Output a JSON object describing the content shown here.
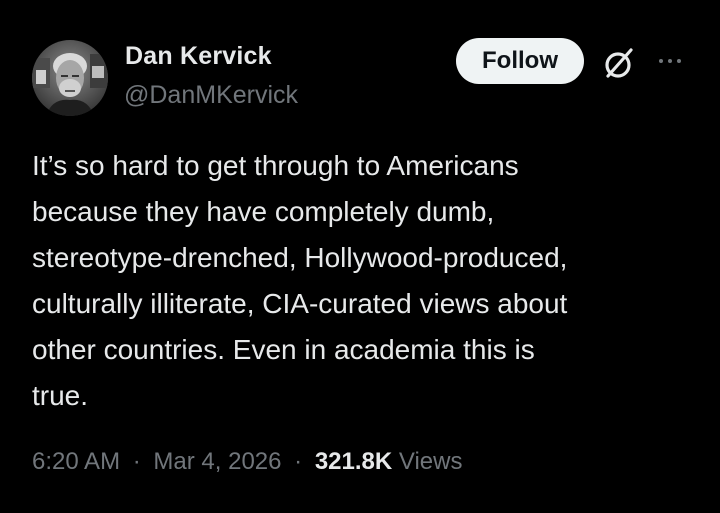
{
  "author": {
    "display_name": "Dan Kervick",
    "handle": "@DanMKervick",
    "avatar_icon": "profile-photo"
  },
  "actions": {
    "follow_label": "Follow",
    "grok_icon": "grok-icon",
    "more_icon": "more-options-icon"
  },
  "tweet": {
    "text": "It’s so hard to get through to Americans\nbecause they have completely dumb,\nstereotype-drenched, Hollywood-produced,\nculturally illiterate, CIA-curated views about\nother countries. Even in academia this is\ntrue."
  },
  "meta": {
    "time": "6:20 AM",
    "date": "Mar 4, 2026",
    "separator": "·",
    "views_count": "321.8K",
    "views_label": "Views"
  },
  "colors": {
    "background": "#000000",
    "primary_text": "#e7e9ea",
    "secondary_text": "#71767b",
    "follow_bg": "#eff3f4",
    "follow_text": "#0f1419"
  }
}
